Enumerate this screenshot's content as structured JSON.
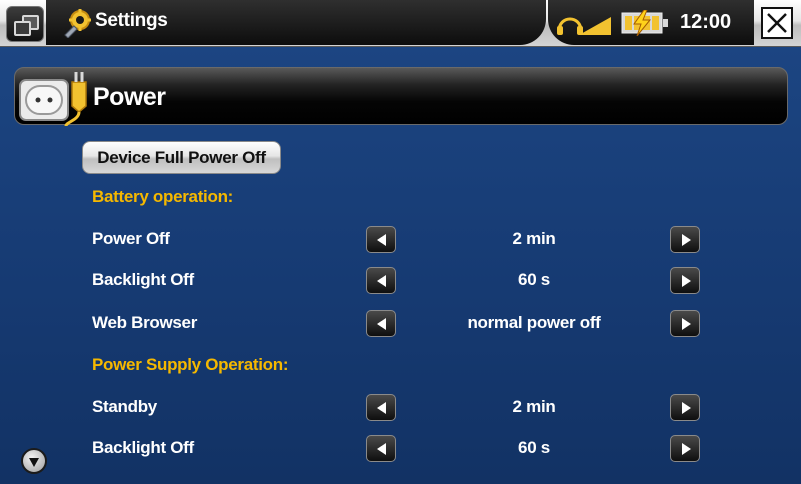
{
  "topbar": {
    "title": "Settings",
    "clock": "12:00",
    "icons": {
      "menu": "window-switch-icon",
      "app": "settings-gear-wrench-icon",
      "headphone": "headphone-icon",
      "battery": "battery-charging-icon",
      "close": "close-icon"
    }
  },
  "section": {
    "title": "Power",
    "icon": "power-plug-icon"
  },
  "full_power_button": "Device Full Power Off",
  "battery_operation": {
    "heading": "Battery operation:",
    "rows": [
      {
        "label": "Power Off",
        "value": "2 min"
      },
      {
        "label": "Backlight Off",
        "value": "60 s"
      },
      {
        "label": "Web Browser",
        "value": "normal power off"
      }
    ]
  },
  "power_supply_operation": {
    "heading": "Power Supply Operation:",
    "rows": [
      {
        "label": "Standby",
        "value": "2 min"
      },
      {
        "label": "Backlight Off",
        "value": "60 s"
      }
    ]
  },
  "colors": {
    "background": "#1a3f7d",
    "heading_accent": "#f5b800",
    "text": "#ffffff"
  }
}
